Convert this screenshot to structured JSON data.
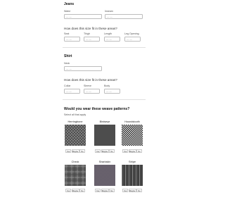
{
  "jeans": {
    "title": "Jeans",
    "waist": {
      "label": "Waist",
      "placeholder": "— —"
    },
    "inseam": {
      "label": "Inseam",
      "placeholder": "— —"
    },
    "fit_question": "How does this size fit in these areas?",
    "fit_fields": [
      {
        "label": "Seat",
        "placeholder": "— —"
      },
      {
        "label": "Thigh",
        "placeholder": "— —"
      },
      {
        "label": "Length",
        "placeholder": "— —"
      },
      {
        "label": "Leg Opening",
        "placeholder": "— —"
      }
    ]
  },
  "shirt": {
    "title": "Shirt",
    "neck": {
      "label": "Neck",
      "placeholder": "— —"
    },
    "fit_question": "How does this size fit in these areas?",
    "fit_fields": [
      {
        "label": "Collar",
        "placeholder": "— —"
      },
      {
        "label": "Sleeve",
        "placeholder": "— —"
      },
      {
        "label": "Body",
        "placeholder": "— —"
      }
    ]
  },
  "patterns": {
    "question": "Would you wear these weave patterns?",
    "hint": "Select all that apply",
    "items": [
      {
        "name": "Herringbone",
        "options": [
          "Yes",
          "Maybe",
          "No"
        ]
      },
      {
        "name": "Birdseye",
        "options": [
          "Yes",
          "Maybe",
          "No"
        ]
      },
      {
        "name": "Houndstooth",
        "options": [
          "Yes",
          "Maybe",
          "No"
        ]
      },
      {
        "name": "Check",
        "options": [
          "Yes",
          "Maybe",
          "No"
        ]
      },
      {
        "name": "Sharkskin",
        "options": [
          "Yes",
          "Maybe",
          "No"
        ]
      },
      {
        "name": "Stripe",
        "options": [
          "Yes",
          "Maybe",
          "No"
        ]
      }
    ]
  },
  "colors": {
    "swatch_dark": "#3a3a3a",
    "swatch_light": "#9a9a9a",
    "border": "#bdbdbd"
  }
}
